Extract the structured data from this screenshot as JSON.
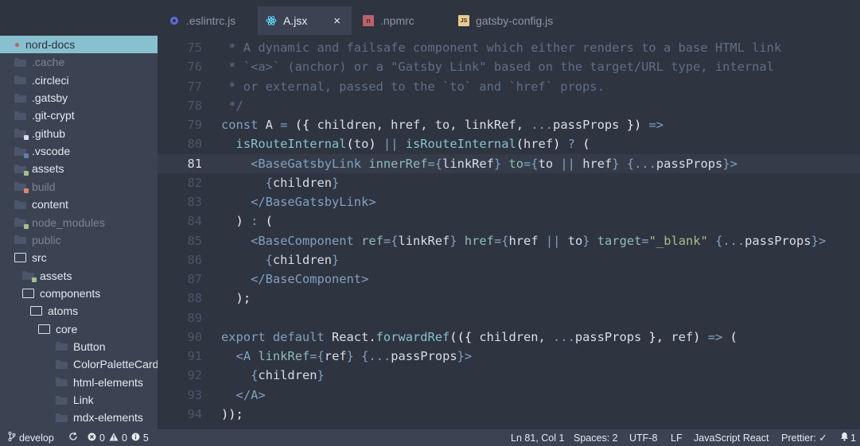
{
  "tabs": [
    {
      "label": ".eslintrc.js",
      "icon": "eslint-icon",
      "icon_color": "#8080f2"
    },
    {
      "label": "A.jsx",
      "icon": "react-icon",
      "icon_color": "#61dafb",
      "close": "×",
      "active": true
    },
    {
      "label": ".npmrc",
      "icon": "npm-icon",
      "icon_color": "#bf616a"
    },
    {
      "label": "gatsby-config.js",
      "icon": "js-icon",
      "icon_color": "#ebcb8b"
    }
  ],
  "sidebar": {
    "items": [
      {
        "label": "nord-docs",
        "depth": 0,
        "selected": true,
        "kind": "root"
      },
      {
        "label": ".cache",
        "depth": 0,
        "dim": true,
        "kind": "folder"
      },
      {
        "label": ".circleci",
        "depth": 0,
        "kind": "folder"
      },
      {
        "label": ".gatsby",
        "depth": 0,
        "kind": "folder"
      },
      {
        "label": ".git-crypt",
        "depth": 0,
        "kind": "folder"
      },
      {
        "label": ".github",
        "depth": 0,
        "kind": "folder",
        "badge": "#d8dee9"
      },
      {
        "label": ".vscode",
        "depth": 0,
        "kind": "folder",
        "badge": "#5e81ac"
      },
      {
        "label": "assets",
        "depth": 0,
        "kind": "folder",
        "badge": "#a3be8c"
      },
      {
        "label": "build",
        "depth": 0,
        "dim": true,
        "kind": "folder",
        "badge": "#d08770"
      },
      {
        "label": "content",
        "depth": 0,
        "kind": "folder"
      },
      {
        "label": "node_modules",
        "depth": 0,
        "dim": true,
        "kind": "folder",
        "badge": "#a3be8c"
      },
      {
        "label": "public",
        "depth": 0,
        "dim": true,
        "kind": "folder"
      },
      {
        "label": "src",
        "depth": 0,
        "kind": "open"
      },
      {
        "label": "assets",
        "depth": 1,
        "kind": "folder",
        "badge": "#a3be8c"
      },
      {
        "label": "components",
        "depth": 1,
        "kind": "open"
      },
      {
        "label": "atoms",
        "depth": 2,
        "kind": "open"
      },
      {
        "label": "core",
        "depth": 3,
        "kind": "open"
      },
      {
        "label": "Button",
        "depth": 4,
        "kind": "folder"
      },
      {
        "label": "ColorPaletteCard",
        "depth": 4,
        "kind": "folder"
      },
      {
        "label": "html-elements",
        "depth": 4,
        "kind": "folder"
      },
      {
        "label": "Link",
        "depth": 4,
        "kind": "folder"
      },
      {
        "label": "mdx-elements",
        "depth": 4,
        "kind": "folder"
      }
    ]
  },
  "editor": {
    "current_line": 81,
    "lines": [
      {
        "n": "75",
        "tokens": [
          [
            "cm",
            " * A dynamic and failsafe component which either renders to a base HTML link"
          ]
        ]
      },
      {
        "n": "76",
        "tokens": [
          [
            "cm",
            " * `<a>` (anchor) or a \"Gatsby Link\" based on the target/URL type, internal"
          ]
        ]
      },
      {
        "n": "77",
        "tokens": [
          [
            "cm",
            " * or external, passed to the `to` and `href` props."
          ]
        ]
      },
      {
        "n": "78",
        "tokens": [
          [
            "cm",
            " */"
          ]
        ]
      },
      {
        "n": "79",
        "tokens": [
          [
            "kw",
            "const "
          ],
          [
            "tx",
            "A "
          ],
          [
            "op",
            "= "
          ],
          [
            "pn",
            "({ "
          ],
          [
            "tx",
            "children, href, to, linkRef, "
          ],
          [
            "op",
            "..."
          ],
          [
            "tx",
            "passProps "
          ],
          [
            "pn",
            "}) "
          ],
          [
            "op",
            "=>"
          ]
        ]
      },
      {
        "n": "80",
        "tokens": [
          [
            "tx",
            "  "
          ],
          [
            "fn",
            "isRouteInternal"
          ],
          [
            "pn",
            "("
          ],
          [
            "tx",
            "to"
          ],
          [
            "pn",
            ") "
          ],
          [
            "op",
            "|| "
          ],
          [
            "fn",
            "isRouteInternal"
          ],
          [
            "pn",
            "("
          ],
          [
            "tx",
            "href"
          ],
          [
            "pn",
            ") "
          ],
          [
            "op",
            "? "
          ],
          [
            "pn",
            "("
          ]
        ]
      },
      {
        "n": "81",
        "tokens": [
          [
            "tx",
            "    "
          ],
          [
            "tg",
            "<BaseGatsbyLink "
          ],
          [
            "at",
            "innerRef"
          ],
          [
            "op",
            "="
          ],
          [
            "kw",
            "{"
          ],
          [
            "tx",
            "linkRef"
          ],
          [
            "kw",
            "} "
          ],
          [
            "at",
            "to"
          ],
          [
            "op",
            "="
          ],
          [
            "kw",
            "{"
          ],
          [
            "tx",
            "to "
          ],
          [
            "op",
            "|| "
          ],
          [
            "tx",
            "href"
          ],
          [
            "kw",
            "} {"
          ],
          [
            "op",
            "..."
          ],
          [
            "tx",
            "passProps"
          ],
          [
            "kw",
            "}"
          ],
          [
            "tg",
            ">"
          ]
        ]
      },
      {
        "n": "82",
        "tokens": [
          [
            "tx",
            "      "
          ],
          [
            "kw",
            "{"
          ],
          [
            "tx",
            "children"
          ],
          [
            "kw",
            "}"
          ]
        ]
      },
      {
        "n": "83",
        "tokens": [
          [
            "tx",
            "    "
          ],
          [
            "tg",
            "</BaseGatsbyLink>"
          ]
        ]
      },
      {
        "n": "84",
        "tokens": [
          [
            "tx",
            "  "
          ],
          [
            "pn",
            ") "
          ],
          [
            "op",
            ": "
          ],
          [
            "pn",
            "("
          ]
        ]
      },
      {
        "n": "85",
        "tokens": [
          [
            "tx",
            "    "
          ],
          [
            "tg",
            "<BaseComponent "
          ],
          [
            "at",
            "ref"
          ],
          [
            "op",
            "="
          ],
          [
            "kw",
            "{"
          ],
          [
            "tx",
            "linkRef"
          ],
          [
            "kw",
            "} "
          ],
          [
            "at",
            "href"
          ],
          [
            "op",
            "="
          ],
          [
            "kw",
            "{"
          ],
          [
            "tx",
            "href "
          ],
          [
            "op",
            "|| "
          ],
          [
            "tx",
            "to"
          ],
          [
            "kw",
            "} "
          ],
          [
            "at",
            "target"
          ],
          [
            "op",
            "="
          ],
          [
            "st",
            "\"_blank\" "
          ],
          [
            "kw",
            "{"
          ],
          [
            "op",
            "..."
          ],
          [
            "tx",
            "passProps"
          ],
          [
            "kw",
            "}"
          ],
          [
            "tg",
            ">"
          ]
        ]
      },
      {
        "n": "86",
        "tokens": [
          [
            "tx",
            "      "
          ],
          [
            "kw",
            "{"
          ],
          [
            "tx",
            "children"
          ],
          [
            "kw",
            "}"
          ]
        ]
      },
      {
        "n": "87",
        "tokens": [
          [
            "tx",
            "    "
          ],
          [
            "tg",
            "</BaseComponent>"
          ]
        ]
      },
      {
        "n": "88",
        "tokens": [
          [
            "tx",
            "  "
          ],
          [
            "pn",
            ");"
          ]
        ]
      },
      {
        "n": "89",
        "tokens": []
      },
      {
        "n": "90",
        "tokens": [
          [
            "kw",
            "export default "
          ],
          [
            "tx",
            "React"
          ],
          [
            "pn",
            "."
          ],
          [
            "fn",
            "forwardRef"
          ],
          [
            "pn",
            "(({ "
          ],
          [
            "tx",
            "children, "
          ],
          [
            "op",
            "..."
          ],
          [
            "tx",
            "passProps "
          ],
          [
            "pn",
            "}, "
          ],
          [
            "tx",
            "ref"
          ],
          [
            "pn",
            ") "
          ],
          [
            "op",
            "=> "
          ],
          [
            "pn",
            "("
          ]
        ]
      },
      {
        "n": "91",
        "tokens": [
          [
            "tx",
            "  "
          ],
          [
            "tg",
            "<A "
          ],
          [
            "at",
            "linkRef"
          ],
          [
            "op",
            "="
          ],
          [
            "kw",
            "{"
          ],
          [
            "tx",
            "ref"
          ],
          [
            "kw",
            "} {"
          ],
          [
            "op",
            "..."
          ],
          [
            "tx",
            "passProps"
          ],
          [
            "kw",
            "}"
          ],
          [
            "tg",
            ">"
          ]
        ]
      },
      {
        "n": "92",
        "tokens": [
          [
            "tx",
            "    "
          ],
          [
            "kw",
            "{"
          ],
          [
            "tx",
            "children"
          ],
          [
            "kw",
            "}"
          ]
        ]
      },
      {
        "n": "93",
        "tokens": [
          [
            "tx",
            "  "
          ],
          [
            "tg",
            "</A>"
          ]
        ]
      },
      {
        "n": "94",
        "tokens": [
          [
            "pn",
            "));"
          ]
        ]
      }
    ]
  },
  "status": {
    "branch_icon": "git-branch-icon",
    "branch": "develop",
    "sync_icon": "sync-icon",
    "errors": "0",
    "warnings": "0",
    "infos": "5",
    "position": "Ln 81, Col 1",
    "spaces": "Spaces: 2",
    "encoding": "UTF-8",
    "eol": "LF",
    "language": "JavaScript React",
    "formatter": "Prettier: ✓",
    "notifications": "1"
  },
  "colors": {
    "background": "#2e3440",
    "sidebar": "#3b4252",
    "selection": "#88c0d0",
    "comment": "#616e88",
    "keyword": "#81a1c1"
  }
}
